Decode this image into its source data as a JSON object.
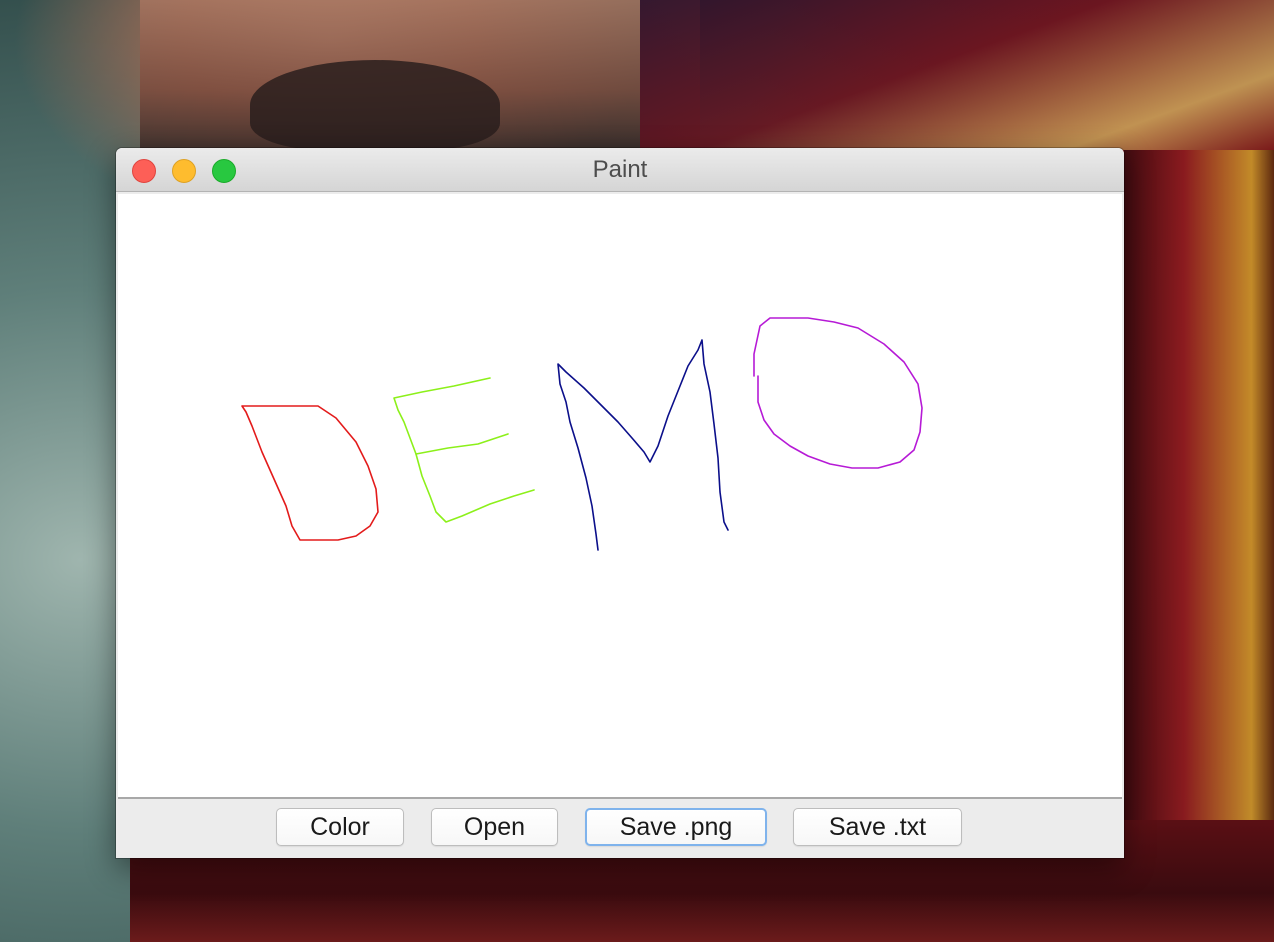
{
  "window": {
    "title": "Paint"
  },
  "traffic_lights": {
    "close_color": "#fd5f57",
    "minimize_color": "#febc2e",
    "zoom_color": "#28c840"
  },
  "canvas": {
    "strokes": [
      {
        "letter": "D",
        "color": "#e31b1b"
      },
      {
        "letter": "E",
        "color": "#8cf01a"
      },
      {
        "letter": "M",
        "color": "#0b0f8a"
      },
      {
        "letter": "O",
        "color": "#b61ad6"
      }
    ]
  },
  "toolbar": {
    "color_label": "Color",
    "open_label": "Open",
    "save_png_label": "Save .png",
    "save_txt_label": "Save .txt",
    "focused_button": "Save .png"
  }
}
